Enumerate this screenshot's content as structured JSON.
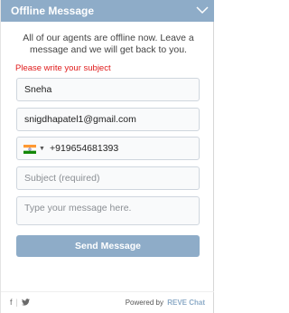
{
  "header": {
    "title": "Offline Message",
    "toggle_icon": "chevron-down-icon"
  },
  "intro": {
    "text": "All of our agents are offline now. Leave a message and we will get back to you."
  },
  "error": {
    "text": "Please write your subject"
  },
  "form": {
    "name_value": "Sneha",
    "email_value": "snigdhapatel1@gmail.com",
    "phone": {
      "country_flag": "india-flag-icon",
      "value": "+919654681393"
    },
    "subject_placeholder": "Subject (required)",
    "message_placeholder": "Type your message here.",
    "send_label": "Send Message"
  },
  "footer": {
    "facebook_icon": "f",
    "twitter_icon": "twitter-icon",
    "powered_by": "Powered by",
    "brand": "REVE Chat"
  },
  "colors": {
    "accent": "#8eacc8",
    "error": "#e01b1b"
  }
}
